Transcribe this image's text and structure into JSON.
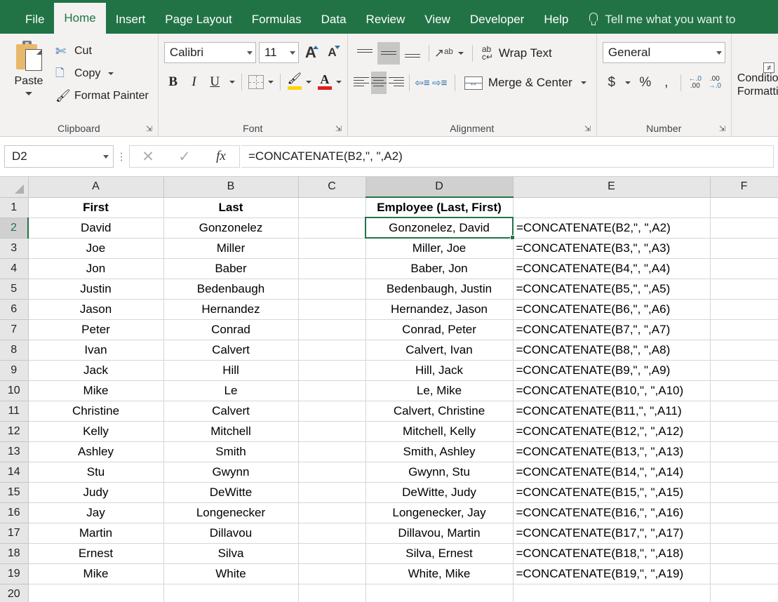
{
  "ribbon": {
    "tabs": [
      {
        "label": "File",
        "active": false
      },
      {
        "label": "Home",
        "active": true
      },
      {
        "label": "Insert",
        "active": false
      },
      {
        "label": "Page Layout",
        "active": false
      },
      {
        "label": "Formulas",
        "active": false
      },
      {
        "label": "Data",
        "active": false
      },
      {
        "label": "Review",
        "active": false
      },
      {
        "label": "View",
        "active": false
      },
      {
        "label": "Developer",
        "active": false
      },
      {
        "label": "Help",
        "active": false
      }
    ],
    "tellme": "Tell me what you want to",
    "groups": {
      "clipboard": {
        "label": "Clipboard",
        "paste": "Paste",
        "cut": "Cut",
        "copy": "Copy",
        "format_painter": "Format Painter"
      },
      "font": {
        "label": "Font",
        "font_family": "Calibri",
        "font_size": "11",
        "bold": "B",
        "italic": "I",
        "underline": "U"
      },
      "alignment": {
        "label": "Alignment",
        "wrap_text": "Wrap Text",
        "merge_center": "Merge & Center"
      },
      "number": {
        "label": "Number",
        "format": "General",
        "currency": "$",
        "percent": "%",
        "comma": ",",
        "increase_decimal": ".0",
        "decrease_decimal": ".00"
      },
      "styles": {
        "conditional_formatting_line1": "Conditio",
        "conditional_formatting_line2": "Formatti",
        "cf_badge": "≠"
      }
    }
  },
  "formula_bar": {
    "name_box": "D2",
    "formula": "=CONCATENATE(B2,\", \",A2)"
  },
  "sheet": {
    "columns": [
      "A",
      "B",
      "C",
      "D",
      "E",
      "F"
    ],
    "selected_column": "D",
    "selected_row": 2,
    "selected_cell": "D2",
    "rows": [
      {
        "n": "1",
        "A": "First",
        "B": "Last",
        "C": "",
        "D": "Employee (Last, First)",
        "E": "",
        "F": ""
      },
      {
        "n": "2",
        "A": "David",
        "B": "Gonzonelez",
        "C": "",
        "D": "Gonzonelez, David",
        "E": "=CONCATENATE(B2,\", \",A2)",
        "F": ""
      },
      {
        "n": "3",
        "A": "Joe",
        "B": "Miller",
        "C": "",
        "D": "Miller, Joe",
        "E": "=CONCATENATE(B3,\", \",A3)",
        "F": ""
      },
      {
        "n": "4",
        "A": "Jon",
        "B": "Baber",
        "C": "",
        "D": "Baber, Jon",
        "E": "=CONCATENATE(B4,\", \",A4)",
        "F": ""
      },
      {
        "n": "5",
        "A": "Justin",
        "B": "Bedenbaugh",
        "C": "",
        "D": "Bedenbaugh, Justin",
        "E": "=CONCATENATE(B5,\", \",A5)",
        "F": ""
      },
      {
        "n": "6",
        "A": "Jason",
        "B": "Hernandez",
        "C": "",
        "D": "Hernandez, Jason",
        "E": "=CONCATENATE(B6,\", \",A6)",
        "F": ""
      },
      {
        "n": "7",
        "A": "Peter",
        "B": "Conrad",
        "C": "",
        "D": "Conrad, Peter",
        "E": "=CONCATENATE(B7,\", \",A7)",
        "F": ""
      },
      {
        "n": "8",
        "A": "Ivan",
        "B": "Calvert",
        "C": "",
        "D": "Calvert, Ivan",
        "E": "=CONCATENATE(B8,\", \",A8)",
        "F": ""
      },
      {
        "n": "9",
        "A": "Jack",
        "B": "Hill",
        "C": "",
        "D": "Hill, Jack",
        "E": "=CONCATENATE(B9,\", \",A9)",
        "F": ""
      },
      {
        "n": "10",
        "A": "Mike",
        "B": "Le",
        "C": "",
        "D": "Le, Mike",
        "E": "=CONCATENATE(B10,\", \",A10)",
        "F": ""
      },
      {
        "n": "11",
        "A": "Christine",
        "B": "Calvert",
        "C": "",
        "D": "Calvert, Christine",
        "E": "=CONCATENATE(B11,\", \",A11)",
        "F": ""
      },
      {
        "n": "12",
        "A": "Kelly",
        "B": "Mitchell",
        "C": "",
        "D": "Mitchell, Kelly",
        "E": "=CONCATENATE(B12,\", \",A12)",
        "F": ""
      },
      {
        "n": "13",
        "A": "Ashley",
        "B": "Smith",
        "C": "",
        "D": "Smith, Ashley",
        "E": "=CONCATENATE(B13,\", \",A13)",
        "F": ""
      },
      {
        "n": "14",
        "A": "Stu",
        "B": "Gwynn",
        "C": "",
        "D": "Gwynn, Stu",
        "E": "=CONCATENATE(B14,\", \",A14)",
        "F": ""
      },
      {
        "n": "15",
        "A": "Judy",
        "B": "DeWitte",
        "C": "",
        "D": "DeWitte, Judy",
        "E": "=CONCATENATE(B15,\", \",A15)",
        "F": ""
      },
      {
        "n": "16",
        "A": "Jay",
        "B": "Longenecker",
        "C": "",
        "D": "Longenecker, Jay",
        "E": "=CONCATENATE(B16,\", \",A16)",
        "F": ""
      },
      {
        "n": "17",
        "A": "Martin",
        "B": "Dillavou",
        "C": "",
        "D": "Dillavou, Martin",
        "E": "=CONCATENATE(B17,\", \",A17)",
        "F": ""
      },
      {
        "n": "18",
        "A": "Ernest",
        "B": "Silva",
        "C": "",
        "D": "Silva, Ernest",
        "E": "=CONCATENATE(B18,\", \",A18)",
        "F": ""
      },
      {
        "n": "19",
        "A": "Mike",
        "B": "White",
        "C": "",
        "D": "White, Mike",
        "E": "=CONCATENATE(B19,\", \",A19)",
        "F": ""
      },
      {
        "n": "20",
        "A": "",
        "B": "",
        "C": "",
        "D": "",
        "E": "",
        "F": ""
      }
    ]
  },
  "colors": {
    "ribbon_green": "#217346",
    "ribbon_body": "#f3f2f1",
    "header_gray": "#e6e6e6",
    "selected_header_gray": "#d0d0d0",
    "gridline": "#d6d6d6"
  }
}
